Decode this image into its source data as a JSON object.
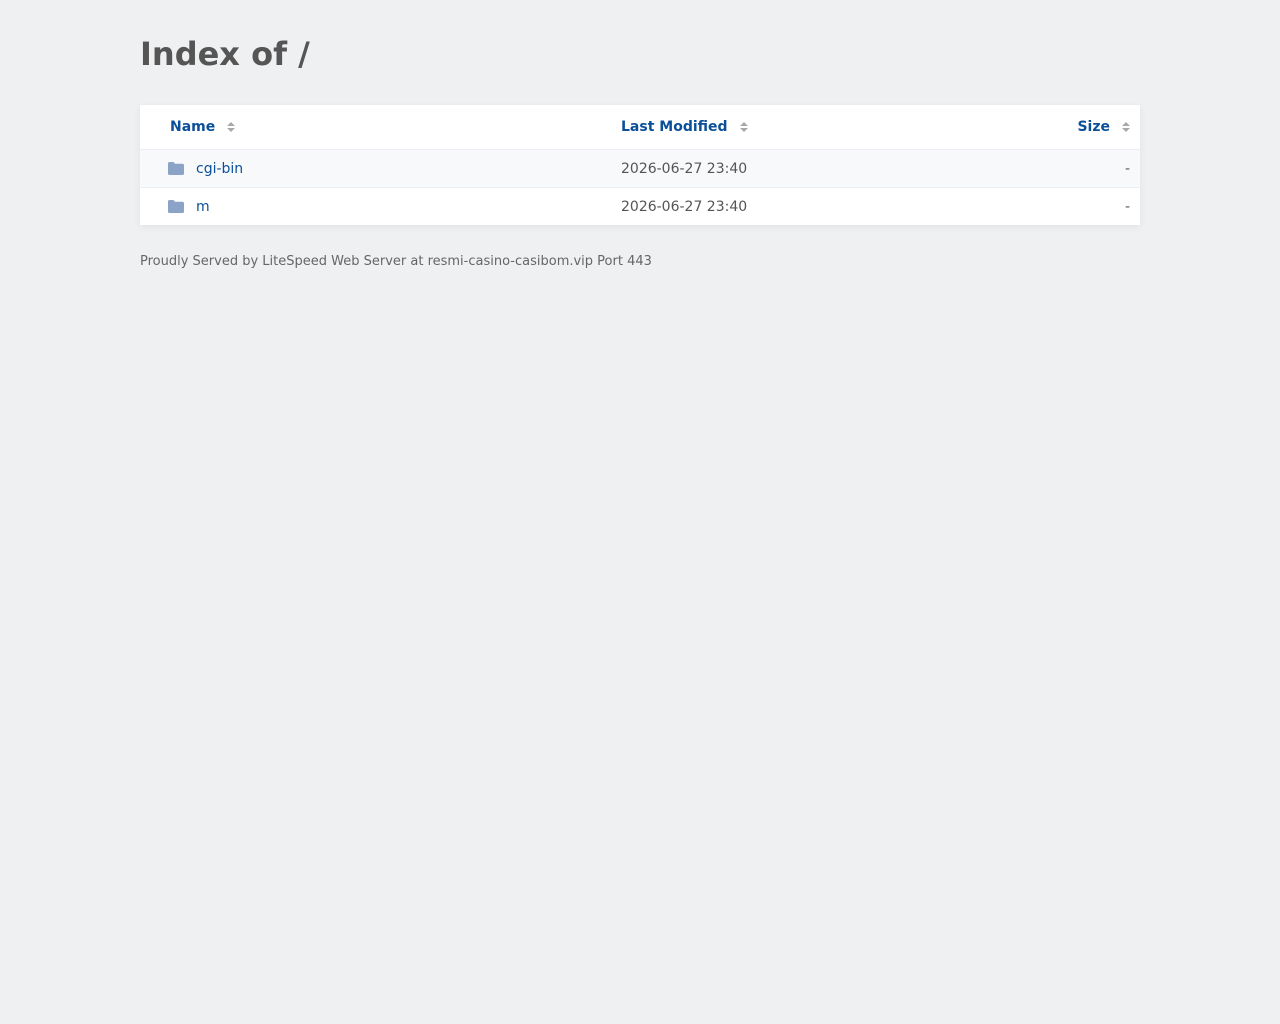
{
  "title": "Index of /",
  "columns": {
    "name": "Name",
    "modified": "Last Modified",
    "size": "Size"
  },
  "entries": [
    {
      "name": "cgi-bin",
      "modified": "2026-06-27 23:40",
      "size": "-",
      "icon": "folder-icon"
    },
    {
      "name": "m",
      "modified": "2026-06-27 23:40",
      "size": "-",
      "icon": "folder-icon"
    }
  ],
  "footer": "Proudly Served by LiteSpeed Web Server at resmi-casino-casibom.vip Port 443",
  "colors": {
    "background": "#eef0f2",
    "link": "#0b4f99",
    "folder": "#8ba3c7"
  }
}
